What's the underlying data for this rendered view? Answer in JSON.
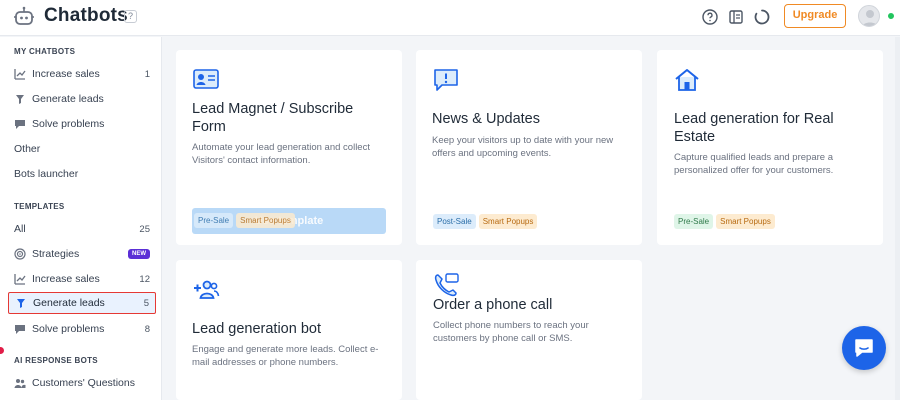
{
  "header": {
    "title": "Chatbots",
    "help": "?",
    "upgrade_label": "Upgrade",
    "icons": [
      "help-circle-icon",
      "book-icon",
      "spinner-icon"
    ]
  },
  "sidebar": {
    "my_chatbots_heading": "MY CHATBOTS",
    "my_chatbots": [
      {
        "label": "Increase sales",
        "count": "1",
        "icon": "chart-icon"
      },
      {
        "label": "Generate leads",
        "count": "",
        "icon": "funnel-icon"
      },
      {
        "label": "Solve problems",
        "count": "",
        "icon": "chat-bubble-icon"
      },
      {
        "label": "Other",
        "count": ""
      },
      {
        "label": "Bots launcher",
        "count": ""
      }
    ],
    "templates_heading": "TEMPLATES",
    "templates": [
      {
        "label": "All",
        "count": "25"
      },
      {
        "label": "Strategies",
        "badge": "NEW",
        "icon": "target-icon"
      },
      {
        "label": "Increase sales",
        "count": "12",
        "icon": "chart-icon"
      },
      {
        "label": "Generate leads",
        "count": "5",
        "icon": "funnel-icon",
        "active": true
      },
      {
        "label": "Solve problems",
        "count": "8",
        "icon": "chat-bubble-icon"
      }
    ],
    "ai_heading": "AI RESPONSE BOTS",
    "ai_items": [
      {
        "label": "Customers' Questions",
        "icon": "people-icon"
      }
    ]
  },
  "cards": [
    {
      "title": "Lead Magnet / Subscribe Form",
      "desc": "Automate your lead generation and collect Visitors' contact information.",
      "tags": [
        "Pre-Sale",
        "Smart Popups"
      ],
      "button": "Use template",
      "icon": "contact-card-icon"
    },
    {
      "title": "News & Updates",
      "desc": "Keep your visitors up to date with your new offers and upcoming events.",
      "tags": [
        "Post-Sale",
        "Smart Popups"
      ],
      "icon": "announcement-icon"
    },
    {
      "title": "Lead generation for Real Estate",
      "desc": "Capture qualified leads and prepare a personalized offer for your customers.",
      "tags": [
        "Pre-Sale",
        "Smart Popups"
      ],
      "icon": "house-icon"
    },
    {
      "title": "Lead generation bot",
      "desc": "Engage and generate more leads. Collect e-mail addresses or phone numbers.",
      "tags": [],
      "icon": "add-user-icon"
    },
    {
      "title": "Order a phone call",
      "desc": "Collect phone numbers to reach your customers by phone call or SMS.",
      "tags": [],
      "icon": "phone-icon"
    }
  ],
  "colors": {
    "accent": "#1d64e8",
    "upgrade": "#f08a24",
    "new_badge": "#5b2fd6",
    "active_border": "#e53935"
  }
}
